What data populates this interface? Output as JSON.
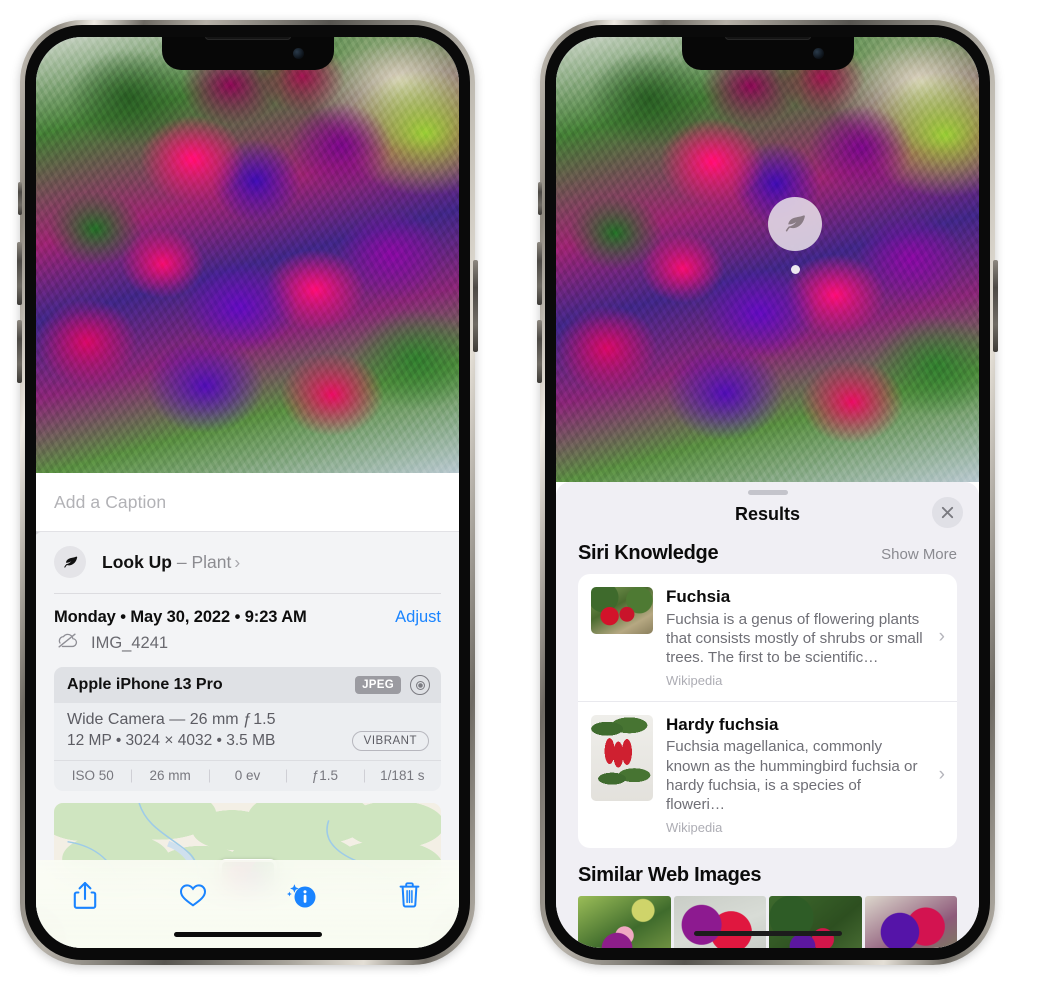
{
  "left_phone": {
    "photo_alt": "fuchsia-flowers-photo",
    "caption": {
      "placeholder": "Add a Caption",
      "value": ""
    },
    "lookup": {
      "icon": "leaf-icon",
      "sparkle": "sparkle-icon",
      "label": "Look Up",
      "separator": " – ",
      "subject": "Plant",
      "chevron": "›"
    },
    "datetime": "Monday • May 30, 2022 • 9:23 AM",
    "adjust_label": "Adjust",
    "cloud_icon": "cloud-slash-icon",
    "filename": "IMG_4241",
    "camera": {
      "model": "Apple iPhone 13 Pro",
      "format_badge": "JPEG",
      "hdr_icon": "hdr-target-icon",
      "lens_line": "Wide Camera — 26 mm ƒ 1.5",
      "spec_line": "12 MP • 3024 × 4032 • 3.5 MB",
      "style_badge": "VIBRANT",
      "exif": [
        "ISO 50",
        "26 mm",
        "0 ev",
        "ƒ1.5",
        "1/181 s"
      ]
    },
    "map": {
      "pin": "photo-pin"
    },
    "toolbar": [
      {
        "name": "share-icon",
        "label": "Share"
      },
      {
        "name": "heart-icon",
        "label": "Favorite"
      },
      {
        "name": "info-sparkle-icon",
        "label": "Info"
      },
      {
        "name": "trash-icon",
        "label": "Delete"
      }
    ],
    "home_indicator": "home-indicator"
  },
  "right_phone": {
    "visual_lookup_badge": {
      "icon": "leaf-icon"
    },
    "sheet": {
      "grabber": "sheet-grabber",
      "title": "Results",
      "close_icon": "close-icon"
    },
    "siri_knowledge": {
      "title": "Siri Knowledge",
      "show_more": "Show More",
      "items": [
        {
          "title": "Fuchsia",
          "description": "Fuchsia is a genus of flowering plants that consists mostly of shrubs or small trees. The first to be scientific…",
          "source": "Wikipedia",
          "thumb": "fuchsia-red-flowers-thumb",
          "chevron": "›"
        },
        {
          "title": "Hardy fuchsia",
          "description": "Fuchsia magellanica, commonly known as the hummingbird fuchsia or hardy fuchsia, is a species of floweri…",
          "source": "Wikipedia",
          "thumb": "hardy-fuchsia-specimen-thumb",
          "chevron": "›"
        }
      ]
    },
    "similar_web_images": {
      "title": "Similar Web Images",
      "thumbs": [
        "fuchsia-web-thumb-1",
        "fuchsia-web-thumb-2",
        "fuchsia-web-thumb-3",
        "fuchsia-web-thumb-4"
      ]
    },
    "home_indicator": "home-indicator"
  },
  "colors": {
    "accent_blue": "#1a84ff",
    "sheet_bg": "#f3f4f6",
    "results_bg": "#f0eff4",
    "card_bg": "#ffffff",
    "secondary_text": "#6f6f76",
    "tertiary_text": "#adadb4"
  }
}
